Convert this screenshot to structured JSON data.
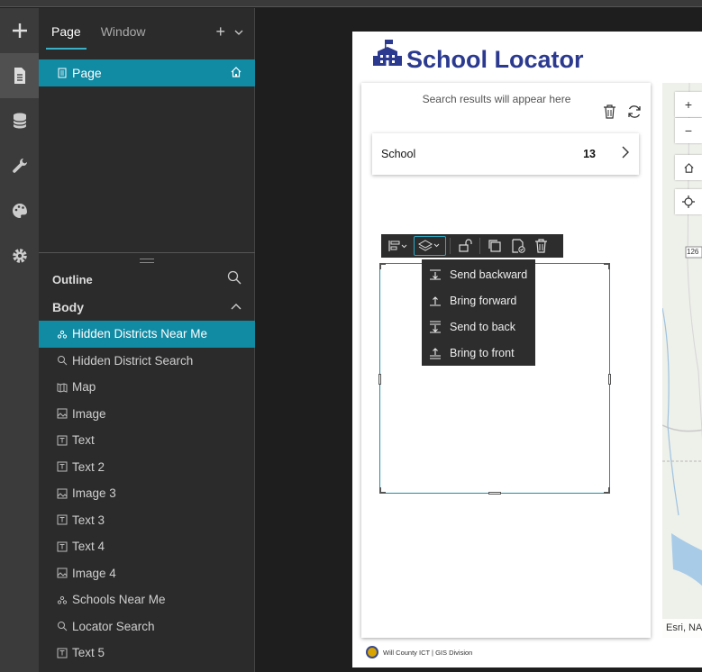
{
  "sidebar": {
    "tabs": [
      {
        "label": "Page"
      },
      {
        "label": "Window"
      }
    ],
    "add_label": "+",
    "page_item": "Page",
    "outline_label": "Outline",
    "body_label": "Body",
    "tree": [
      {
        "label": "Hidden Districts Near Me",
        "icon": "near-me-icon"
      },
      {
        "label": "Hidden District Search",
        "icon": "search-icon"
      },
      {
        "label": "Map",
        "icon": "map-icon"
      },
      {
        "label": "Image",
        "icon": "image-icon"
      },
      {
        "label": "Text",
        "icon": "text-icon"
      },
      {
        "label": "Text 2",
        "icon": "text-icon"
      },
      {
        "label": "Image 3",
        "icon": "image-icon"
      },
      {
        "label": "Text 3",
        "icon": "text-icon"
      },
      {
        "label": "Text 4",
        "icon": "text-icon"
      },
      {
        "label": "Image 4",
        "icon": "image-icon"
      },
      {
        "label": "Schools Near Me",
        "icon": "near-me-icon"
      },
      {
        "label": "Locator Search",
        "icon": "search-icon"
      },
      {
        "label": "Text 5",
        "icon": "text-icon"
      }
    ]
  },
  "app": {
    "title": "School Locator",
    "hint": "Search results will appear here",
    "school_card": {
      "label": "School",
      "count": "13"
    },
    "menu": [
      {
        "label": "Send backward"
      },
      {
        "label": "Bring forward"
      },
      {
        "label": "Send to back"
      },
      {
        "label": "Bring to front"
      }
    ],
    "map_controls": {
      "zoom_in": "+",
      "zoom_out": "−"
    },
    "map_label": "126",
    "attribution": "Esri, NA",
    "footer": "Will County ICT | GIS Division"
  },
  "colors": {
    "accent": "#118aa3",
    "title": "#2b3a8f",
    "rail": "#3b3b3b",
    "panel": "#2b2b2b"
  }
}
